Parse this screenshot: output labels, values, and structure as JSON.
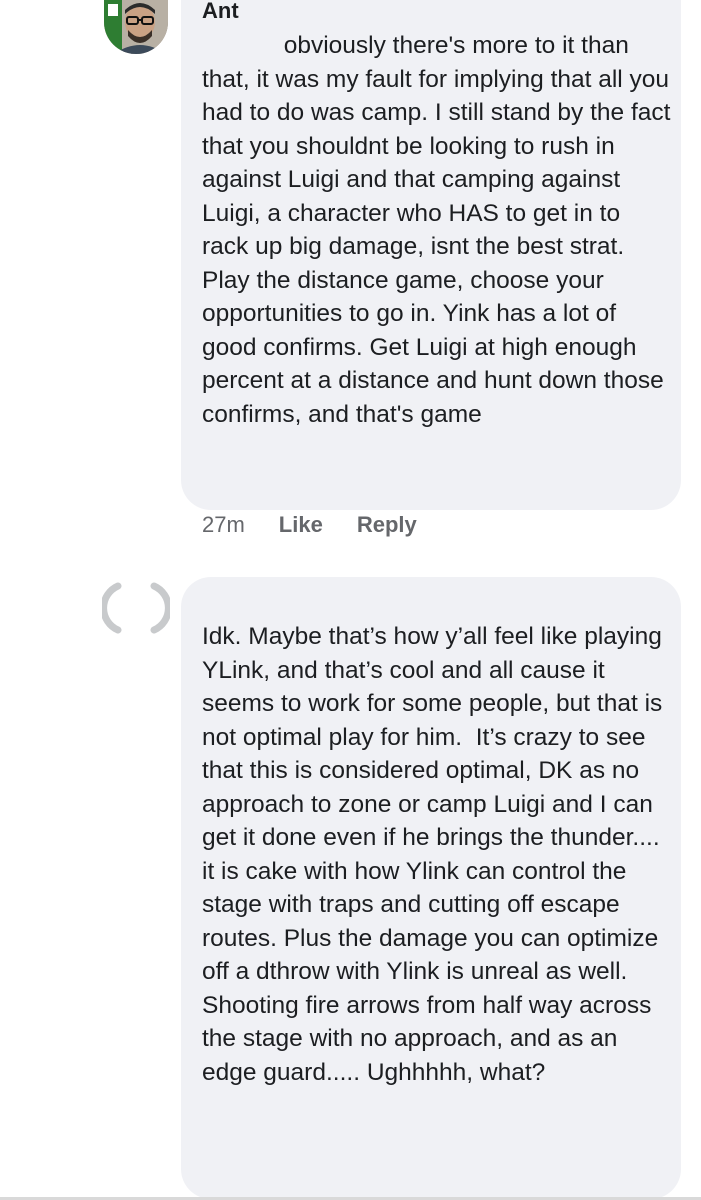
{
  "comments": [
    {
      "author": "Ant",
      "avatar_icon": "user-avatar-photo",
      "text": "            obviously there's more to it than that, it was my fault for implying that all you had to do was camp. I still stand by the fact that you shouldnt be looking to rush in against Luigi and that camping against Luigi, a character who HAS to get in to rack up big damage, isnt the best strat. Play the distance game, choose your opportunities to go in. Yink has a lot of good confirms. Get Luigi at high enough percent at a distance and hunt down those confirms, and that's game",
      "time": "27m",
      "like_label": "Like",
      "reply_label": "Reply"
    },
    {
      "author": "",
      "avatar_icon": "loading-avatar-placeholder",
      "text": "Idk. Maybe that’s how y’all feel like playing YLink, and that’s cool and all cause it seems to work for some people, but that is not optimal play for him.  It’s crazy to see that this is considered optimal, DK as no approach to zone or camp Luigi and I can get it done even if he brings the thunder.... it is cake with how Ylink can control the stage with traps and cutting off escape routes. Plus the damage you can optimize off a dthrow with Ylink is unreal as well. Shooting fire arrows from half way across the stage with no approach, and as an edge guard..... Ughhhhh, what?"
    }
  ],
  "colors": {
    "bubble": "#f0f1f5",
    "text": "#1c1e21",
    "meta": "#65676b"
  }
}
